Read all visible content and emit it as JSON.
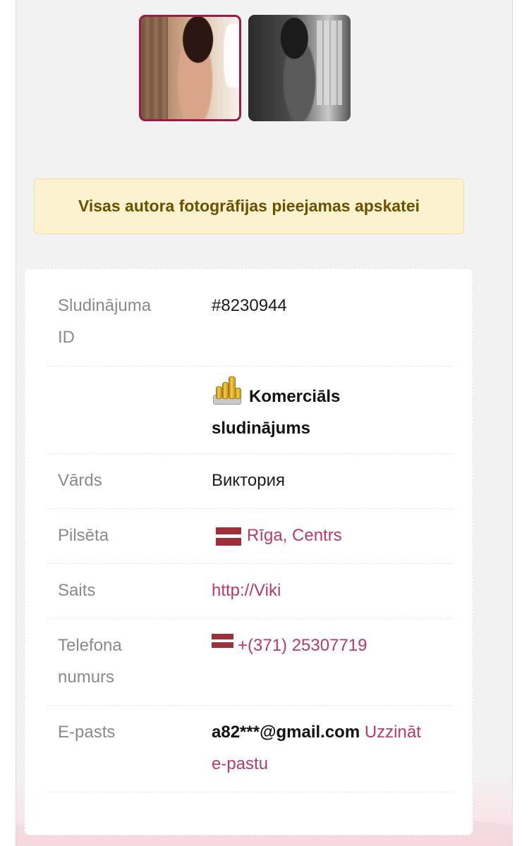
{
  "notice": {
    "text": "Visas autora fotogrāfijas pieejamas apskatei"
  },
  "thumbnails": [
    {
      "selected": true,
      "icon": "photo-thumbnail"
    },
    {
      "selected": false,
      "icon": "photo-thumbnail"
    }
  ],
  "details": {
    "ad_id": {
      "label_line1": "Sludinājuma",
      "label_line2": "ID",
      "value": "#8230944"
    },
    "ad_type": {
      "icon": "coins-icon",
      "value_line1": "Komerciāls",
      "value_line2": "sludinājums"
    },
    "name": {
      "label": "Vārds",
      "value": "Виктория"
    },
    "city": {
      "label": "Pilsēta",
      "icon": "latvia-flag-icon",
      "value": "Rīga, Centrs"
    },
    "site": {
      "label": "Saits",
      "value": "http://Viki"
    },
    "phone": {
      "label_line1": "Telefona",
      "label_line2": "numurs",
      "icon": "latvia-flag-icon",
      "value": "+(371) 25307719"
    },
    "email": {
      "label": "E-pasts",
      "value": "a82***@gmail.com",
      "reveal_line1": "Uzzināt",
      "reveal_line2": "e-pastu"
    }
  },
  "colors": {
    "accent": "#b83a6a",
    "selected_border": "#9b1b47",
    "notice_bg": "#fdf2cf",
    "notice_text": "#6b5000",
    "flag_red": "#9e3039"
  }
}
